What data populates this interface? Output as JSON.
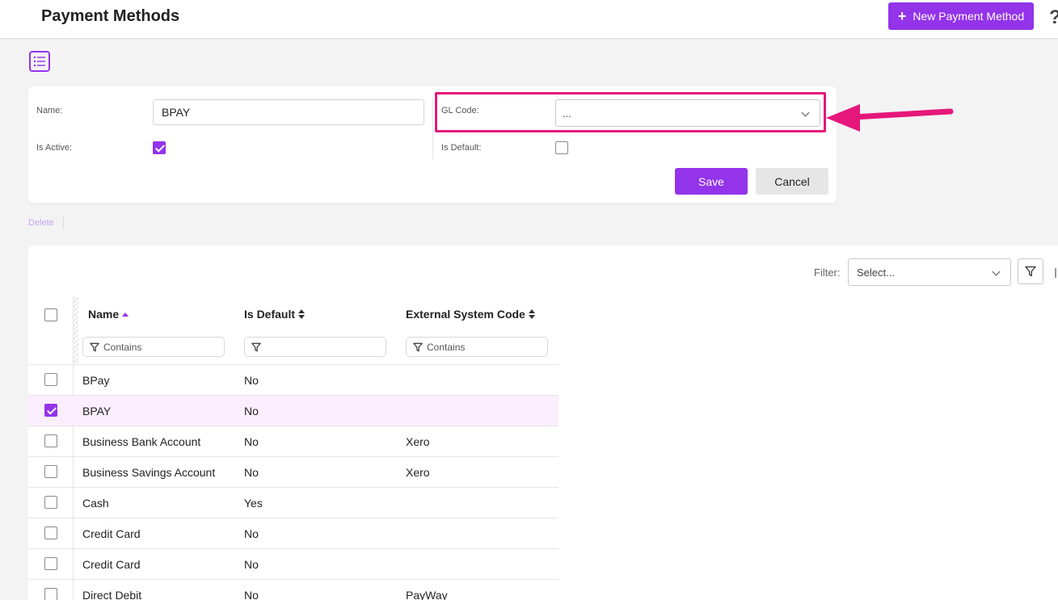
{
  "header": {
    "title": "Payment Methods",
    "new_button_label": "New Payment Method",
    "help_glyph": "?"
  },
  "form": {
    "name_label": "Name:",
    "name_value": "BPAY",
    "is_active_label": "Is Active:",
    "is_active": true,
    "gl_code_label": "GL Code:",
    "gl_code_value": "...",
    "is_default_label": "Is Default:",
    "is_default": false,
    "save_label": "Save",
    "cancel_label": "Cancel"
  },
  "actions": {
    "delete_label": "Delete"
  },
  "grid": {
    "filter_label": "Filter:",
    "filter_placeholder": "Select...",
    "columns": [
      {
        "label": "Name",
        "sort": "asc",
        "filter_placeholder": "Contains"
      },
      {
        "label": "Is Default",
        "sort": "none",
        "filter_placeholder": ""
      },
      {
        "label": "External System Code",
        "sort": "none",
        "filter_placeholder": "Contains"
      }
    ],
    "rows": [
      {
        "name": "BPay",
        "is_default": "No",
        "external_code": "",
        "selected": false
      },
      {
        "name": "BPAY",
        "is_default": "No",
        "external_code": "",
        "selected": true
      },
      {
        "name": "Business Bank Account",
        "is_default": "No",
        "external_code": "Xero",
        "selected": false
      },
      {
        "name": "Business Savings Account",
        "is_default": "No",
        "external_code": "Xero",
        "selected": false
      },
      {
        "name": "Cash",
        "is_default": "Yes",
        "external_code": "",
        "selected": false
      },
      {
        "name": "Credit Card",
        "is_default": "No",
        "external_code": "",
        "selected": false
      },
      {
        "name": "Credit Card",
        "is_default": "No",
        "external_code": "",
        "selected": false
      },
      {
        "name": "Direct Debit",
        "is_default": "No",
        "external_code": "PayWay",
        "selected": false
      }
    ]
  },
  "colors": {
    "accent": "#9333ea",
    "annotation": "#e6177a",
    "selected_row": "#fbeefe"
  },
  "icons": [
    "plus-icon",
    "help-icon",
    "list-view-icon",
    "chevron-down-icon",
    "filter-icon",
    "sort-asc-icon",
    "sort-icon",
    "annotation-arrow-icon"
  ]
}
